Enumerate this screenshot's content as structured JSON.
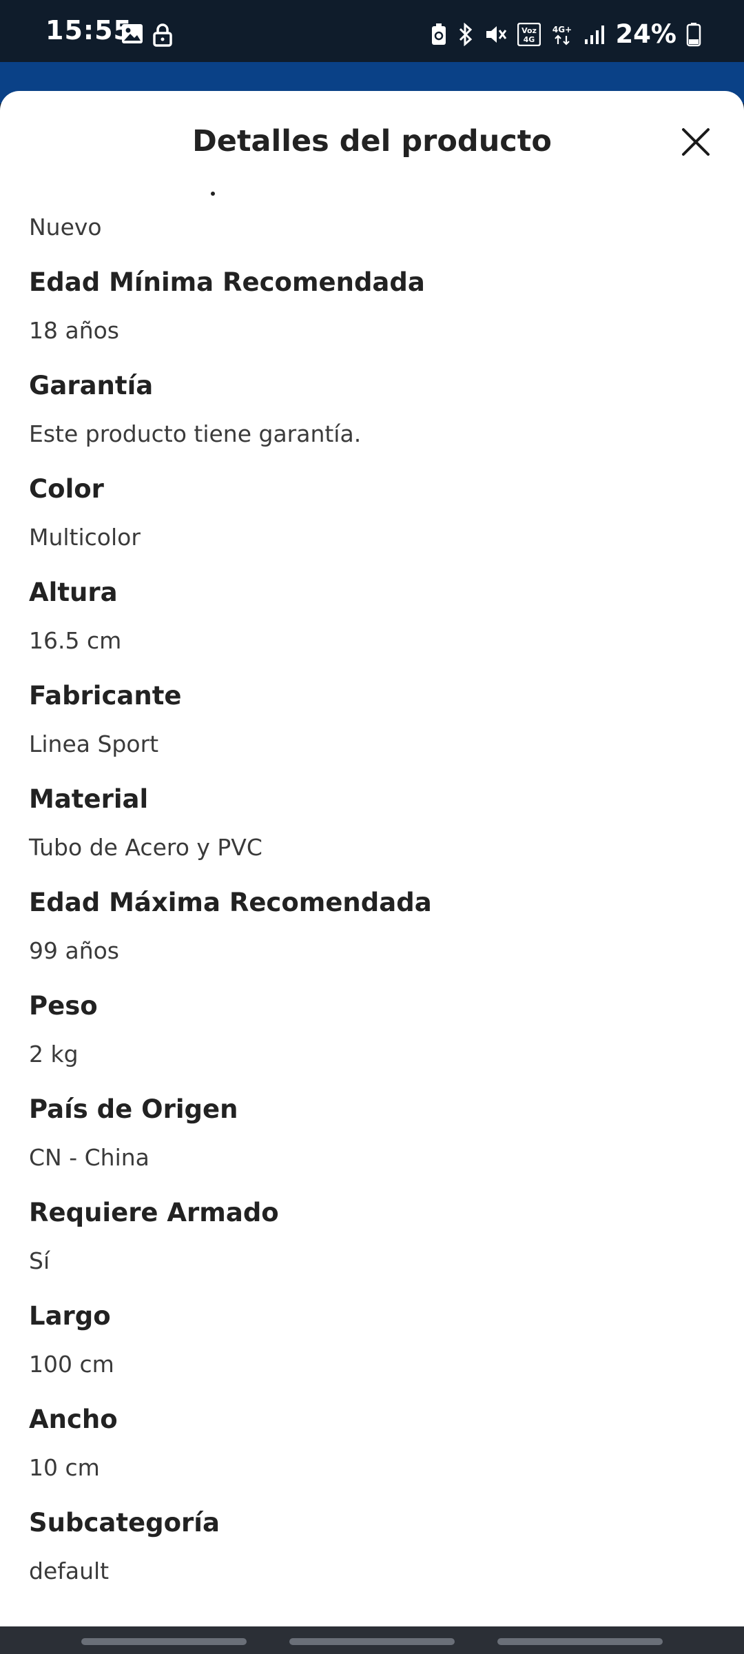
{
  "status_bar": {
    "time": "15:55",
    "battery_percent": "24%",
    "left_icons": [
      "image-icon",
      "lock-icon"
    ],
    "right_icons": [
      "battery-saver-icon",
      "bluetooth-icon",
      "mute-icon",
      "volte-icon",
      "network-4g-icon",
      "signal-icon",
      "battery-icon"
    ]
  },
  "sheet": {
    "title": "Detalles del producto",
    "close_icon": "close-icon"
  },
  "details": {
    "first_value": "Nuevo",
    "items": [
      {
        "label": "Edad Mínima Recomendada",
        "value": "18 años"
      },
      {
        "label": "Garantía",
        "value": "Este producto tiene garantía."
      },
      {
        "label": "Color",
        "value": "Multicolor"
      },
      {
        "label": "Altura",
        "value": "16.5 cm"
      },
      {
        "label": "Fabricante",
        "value": "Linea Sport"
      },
      {
        "label": "Material",
        "value": "Tubo de Acero y PVC"
      },
      {
        "label": "Edad Máxima Recomendada",
        "value": "99 años"
      },
      {
        "label": "Peso",
        "value": "2 kg"
      },
      {
        "label": "País de Origen",
        "value": "CN - China"
      },
      {
        "label": "Requiere Armado",
        "value": "Sí"
      },
      {
        "label": "Largo",
        "value": "100 cm"
      },
      {
        "label": "Ancho",
        "value": "10 cm"
      },
      {
        "label": "Subcategoría",
        "value": "default"
      }
    ]
  },
  "colors": {
    "status_bar_bg": "#0f1c2b",
    "app_blue": "#0a4187",
    "text_primary": "#222222",
    "text_secondary": "#3a3a3a"
  }
}
